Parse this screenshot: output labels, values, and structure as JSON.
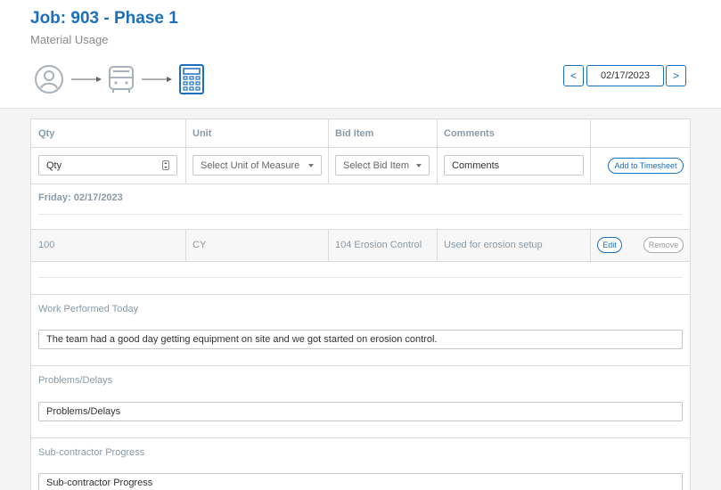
{
  "header": {
    "job_title": "Job: 903 - Phase 1",
    "subtitle": "Material Usage",
    "steps": [
      "person-step-icon",
      "truck-step-icon",
      "calculator-step-icon"
    ],
    "active_step": "calculator-step-icon",
    "accent_color": "#1a6fbf"
  },
  "date_nav": {
    "prev_label": "<",
    "date": "02/17/2023",
    "next_label": ">"
  },
  "table": {
    "columns": [
      "Qty",
      "Unit",
      "Bid Item",
      "Comments"
    ],
    "entry_row": {
      "qty_placeholder": "Qty",
      "unit_select": "Select Unit of Measure",
      "bid_select": "Select Bid Item",
      "comments_placeholder": "Comments",
      "add_label": "Add to Timesheet"
    },
    "day_heading": "Friday: 02/17/2023",
    "rows": [
      {
        "qty": "100",
        "unit": "CY",
        "bid_item": "104 Erosion Control",
        "comments": "Used for erosion setup",
        "edit_label": "Edit",
        "remove_label": "Remove"
      }
    ]
  },
  "sections": {
    "work_label": "Work Performed Today",
    "work_value": "The team had a good day getting equipment on site and we got started on erosion control.",
    "problems_label": "Problems/Delays",
    "problems_placeholder": "Problems/Delays",
    "sub_label": "Sub-contractor Progress",
    "sub_placeholder": "Sub-contractor Progress"
  }
}
